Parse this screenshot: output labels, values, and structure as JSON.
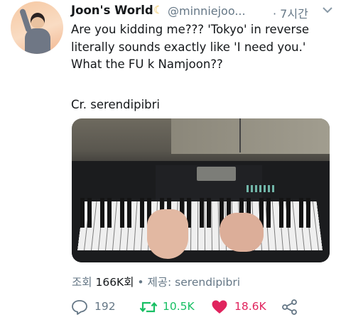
{
  "tweet": {
    "display_name": "Joon's World",
    "handle": "@minniejoo...",
    "time": "· 7시간",
    "lines": [
      "Are you kidding me??? 'Tokyo' in reverse",
      "literally sounds exactly like 'I need you.'",
      "What the FU k Namjoon??"
    ],
    "credit": "Cr. serendipibri"
  },
  "stats": {
    "views_label": "조회",
    "views": "166K회",
    "separator": "•",
    "source": "제공: serendipibri"
  },
  "actions": {
    "reply_count": "192",
    "retweet_count": "10.5K",
    "like_count": "18.6K"
  },
  "colors": {
    "secondary_text": "#657786",
    "retweet_green": "#17bf63",
    "like_red": "#e0245e",
    "moon_emoji": "#f2c14a"
  },
  "icons": [
    "crescent-moon-icon",
    "chevron-down-icon",
    "reply-icon",
    "retweet-icon",
    "heart-icon",
    "share-icon"
  ]
}
